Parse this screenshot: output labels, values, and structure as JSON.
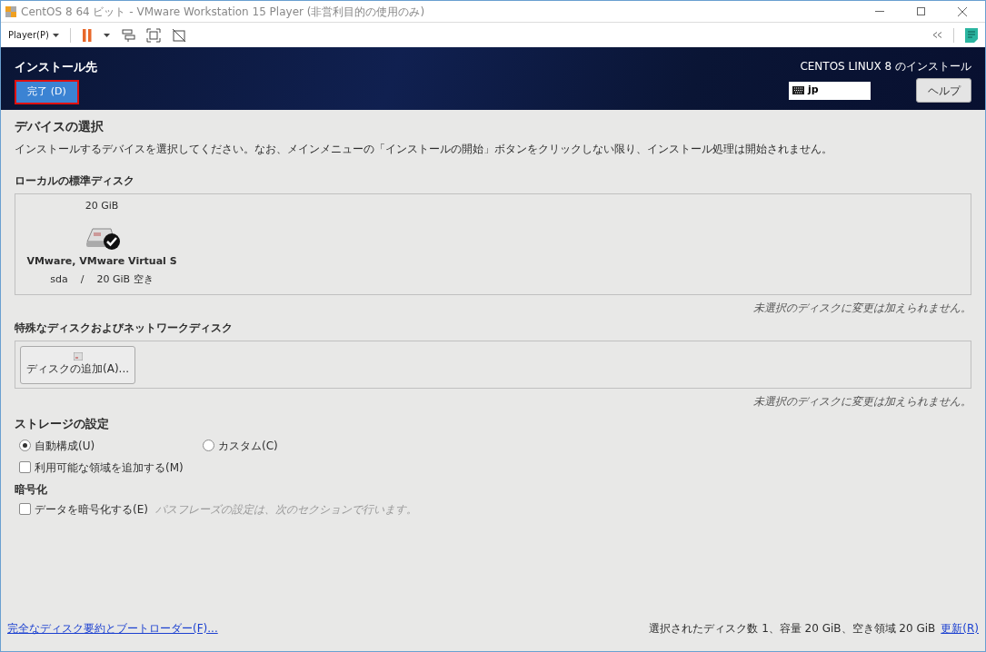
{
  "window": {
    "title": "CentOS 8 64 ビット - VMware Workstation 15 Player (非営利目的の使用のみ)"
  },
  "toolbar": {
    "player_menu": "Player(P)"
  },
  "header": {
    "title": "インストール先",
    "done_button": "完了 (D)",
    "product": "CENTOS LINUX 8 のインストール",
    "keyboard": "jp",
    "help_button": "ヘルプ"
  },
  "device_selection": {
    "heading": "デバイスの選択",
    "description": "インストールするデバイスを選択してください。なお、メインメニューの「インストールの開始」ボタンをクリックしない限り、インストール処理は開始されません。"
  },
  "local_disks": {
    "heading": "ローカルの標準ディスク",
    "disks": [
      {
        "size": "20 GiB",
        "name": "VMware, VMware Virtual S",
        "device": "sda",
        "separator": "/",
        "free": "20 GiB 空き",
        "selected": true
      }
    ],
    "note": "未選択のディスクに変更は加えられません。"
  },
  "special_disks": {
    "heading": "特殊なディスクおよびネットワークディスク",
    "add_button": "ディスクの追加(A)...",
    "note": "未選択のディスクに変更は加えられません。"
  },
  "storage": {
    "heading": "ストレージの設定",
    "options": [
      {
        "label": "自動構成(U)",
        "selected": true
      },
      {
        "label": "カスタム(C)",
        "selected": false
      }
    ],
    "extra_space": {
      "label": "利用可能な領域を追加する(M)",
      "checked": false
    }
  },
  "encryption": {
    "heading": "暗号化",
    "encrypt": {
      "label": "データを暗号化する(E)",
      "checked": false
    },
    "hint": "パスフレーズの設定は、次のセクションで行います。"
  },
  "footer": {
    "summary_link": "完全なディスク要約とブートローダー(F)...",
    "status": "選択されたディスク数 1、容量 20 GiB、空き領域 20 GiB",
    "refresh_link": "更新(R)"
  }
}
